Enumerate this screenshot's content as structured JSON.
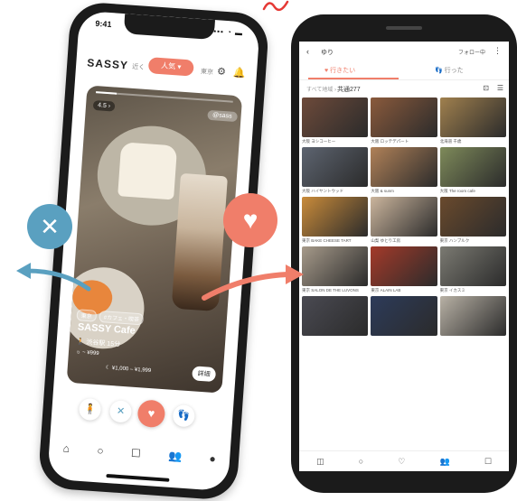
{
  "left_phone": {
    "status_time": "9:41",
    "status_icons": "▪▪▪ ◔ ▬",
    "brand": "SASSY",
    "tabs": {
      "near": "近く",
      "popular": "人気 ▾",
      "tokyo": "東京"
    },
    "header_icons": {
      "settings": "⚙",
      "bell": "🔔"
    },
    "card": {
      "progress": 0.15,
      "rating": "4.5 ›",
      "handle": "@sass",
      "tags": [
        "東京",
        "#カフェ・喫茶"
      ],
      "name": "SASSY Cafe",
      "distance": "🚶 渋谷駅 15分",
      "price_day": "☼ ~ ¥999",
      "price_night": "☾ ¥1,000 – ¥1,999",
      "detail_button": "詳細"
    },
    "actions": {
      "friends": "🧍",
      "dislike": "✕",
      "like": "♥",
      "steps": "👣"
    },
    "bottom_nav": [
      "⌂",
      "○",
      "☐",
      "👥",
      "●"
    ]
  },
  "overlay": {
    "dislike_symbol": "✕",
    "like_symbol": "♥",
    "colors": {
      "like": "#f07e6a",
      "dislike": "#5aa0c0"
    }
  },
  "right_phone": {
    "header": {
      "back": "‹",
      "name": "ゆり",
      "follow": "フォロー中",
      "more": "⋮"
    },
    "tabs": {
      "want": "♥ 行きたい",
      "went": "👣 行った"
    },
    "filter": {
      "crumb": "すべて地域 ›",
      "sub": "共通277",
      "icons": [
        "⊡",
        "☰"
      ]
    },
    "grid": [
      {
        "caption": "大阪 ヨシコーヒー",
        "color": "#6d4a3a"
      },
      {
        "caption": "大阪 ロッテデパート",
        "color": "#8a5a3c"
      },
      {
        "caption": "北海道 千歳",
        "color": "#a0804e"
      },
      {
        "caption": "大阪 ハイヤントウッド",
        "color": "#5d6470"
      },
      {
        "caption": "大阪 & sunm",
        "color": "#b08158"
      },
      {
        "caption": "大阪 The room cafe",
        "color": "#7e8a5a"
      },
      {
        "caption": "東京 BAKE CHEESE TART",
        "color": "#c98b3a"
      },
      {
        "caption": "山梨 ゆとり工房",
        "color": "#cbb59d"
      },
      {
        "caption": "東京 ハンブルク",
        "color": "#6a4a2d"
      },
      {
        "caption": "東京 SALON DE THE LUVONS",
        "color": "#a69a8a"
      },
      {
        "caption": "東京 ALAIN LAB",
        "color": "#a43a2a"
      },
      {
        "caption": "東京 イカスミ",
        "color": "#7b7a72"
      },
      {
        "caption": "",
        "color": "#4a4a52"
      },
      {
        "caption": "",
        "color": "#2d3b5a"
      },
      {
        "caption": "",
        "color": "#b8b1a5"
      }
    ],
    "bottom_nav": [
      "◫",
      "○",
      "♡",
      "👥",
      "☐"
    ]
  }
}
